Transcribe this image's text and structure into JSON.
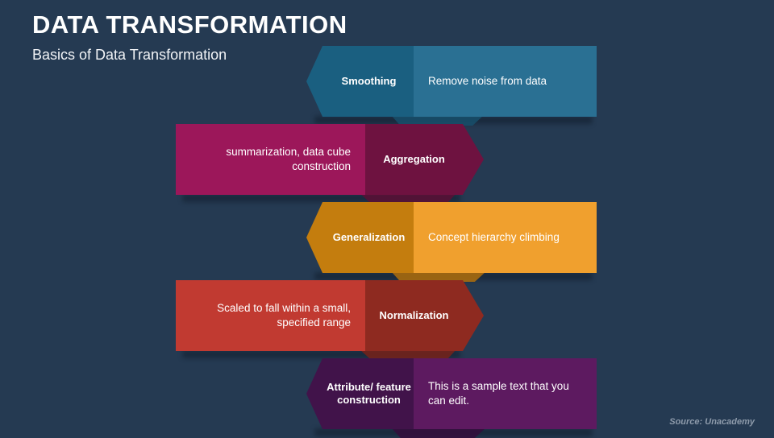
{
  "header": {
    "title": "DATA TRANSFORMATION",
    "subtitle": "Basics of Data Transformation"
  },
  "footer": {
    "source": "Source: Unacademy"
  },
  "colors": {
    "background": "#253a52",
    "title_text": "#ffffff",
    "source_text": "#8e9bab"
  },
  "chart_data": {
    "type": "diagram",
    "title": "DATA TRANSFORMATION",
    "subtitle": "Basics of Data Transformation",
    "layout": "alternating zig-zag chevron list, 5 rows",
    "rows": [
      {
        "label": "Smoothing",
        "description": "Remove noise from data",
        "label_side": "left",
        "chevron_direction": "left",
        "label_color": "#1a5f80",
        "description_color": "#2a7093"
      },
      {
        "label": "Aggregation",
        "description": "summarization, data cube construction",
        "label_side": "right",
        "chevron_direction": "right",
        "label_color": "#6e1240",
        "description_color": "#9c175a"
      },
      {
        "label": "Generalization",
        "description": "Concept hierarchy climbing",
        "label_side": "left",
        "chevron_direction": "left",
        "label_color": "#c47d0e",
        "description_color": "#f0a02e"
      },
      {
        "label": "Normalization",
        "description": "Scaled to fall within a small, specified range",
        "label_side": "right",
        "chevron_direction": "right",
        "label_color": "#8e2a20",
        "description_color": "#c13a31"
      },
      {
        "label": "Attribute/ feature construction",
        "description": "This is a sample text that you can edit.",
        "label_side": "left",
        "chevron_direction": "left",
        "label_color": "#41134a",
        "description_color": "#5d1a60"
      }
    ]
  }
}
